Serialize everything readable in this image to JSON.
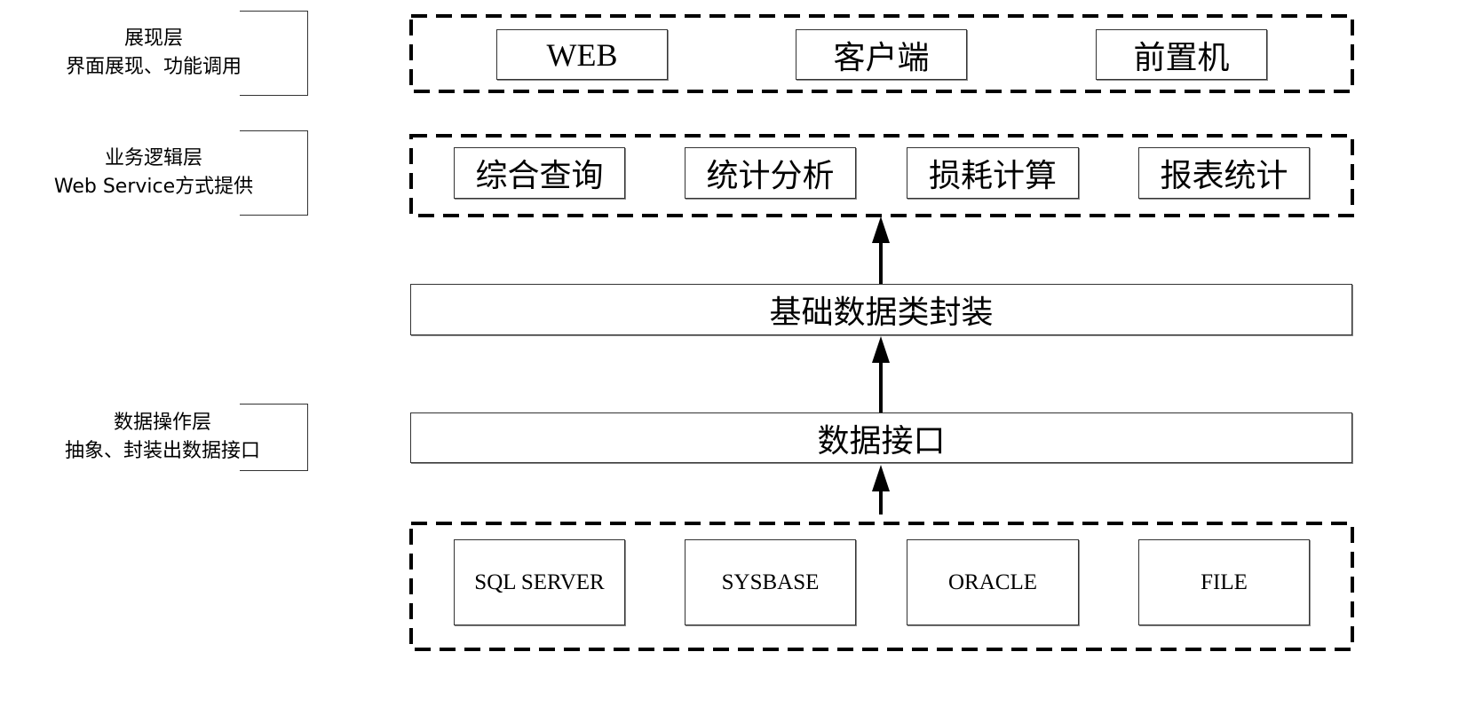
{
  "layers": [
    {
      "title": "展现层",
      "subtitle": "界面展现、功能调用"
    },
    {
      "title": "业务逻辑层",
      "subtitle": "Web Service方式提供"
    },
    {
      "title": "数据操作层",
      "subtitle": "抽象、封装出数据接口"
    }
  ],
  "presentation": [
    "WEB",
    "客户端",
    "前置机"
  ],
  "business": [
    "综合查询",
    "统计分析",
    "损耗计算",
    "报表统计"
  ],
  "encapsulation": "基础数据类封装",
  "data_interface": "数据接口",
  "databases": [
    "SQL SERVER",
    "SYSBASE",
    "ORACLE",
    "FILE"
  ]
}
